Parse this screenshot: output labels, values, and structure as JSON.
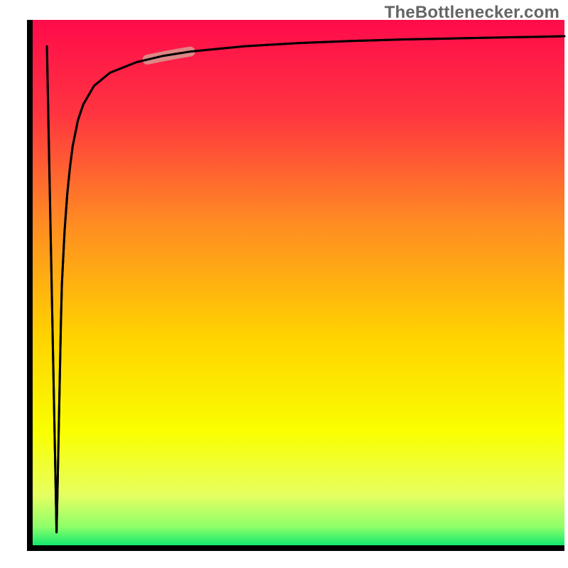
{
  "branding": {
    "watermark": "TheBottlenecker.com"
  },
  "chart_data": {
    "type": "line",
    "title": "",
    "xlabel": "",
    "ylabel": "",
    "xlim": [
      0,
      100
    ],
    "ylim": [
      0,
      100
    ],
    "x": [
      5.0,
      5.2,
      5.4,
      5.6,
      5.8,
      6.0,
      6.5,
      7.0,
      7.5,
      8.0,
      9.0,
      10.0,
      12.0,
      15.0,
      20.0,
      25.0,
      30.0,
      40.0,
      50.0,
      60.0,
      70.0,
      80.0,
      90.0,
      100.0
    ],
    "values": [
      3.0,
      12.0,
      22.0,
      32.0,
      42.0,
      50.0,
      60.0,
      67.0,
      72.0,
      76.0,
      81.0,
      84.0,
      87.5,
      90.0,
      92.0,
      93.2,
      94.0,
      95.0,
      95.6,
      96.0,
      96.3,
      96.5,
      96.7,
      96.9
    ],
    "highlight_range_x": [
      22,
      30
    ],
    "gradient_stops": [
      {
        "offset": 0.0,
        "color": "#ff0b4b"
      },
      {
        "offset": 0.18,
        "color": "#ff3540"
      },
      {
        "offset": 0.38,
        "color": "#ff8a23"
      },
      {
        "offset": 0.6,
        "color": "#ffd300"
      },
      {
        "offset": 0.78,
        "color": "#faff00"
      },
      {
        "offset": 0.9,
        "color": "#e6ff61"
      },
      {
        "offset": 0.96,
        "color": "#8cff6a"
      },
      {
        "offset": 1.0,
        "color": "#00e66e"
      }
    ],
    "axis_color": "#000000",
    "curve_color": "#000000",
    "highlight_color": "#d79a91"
  }
}
